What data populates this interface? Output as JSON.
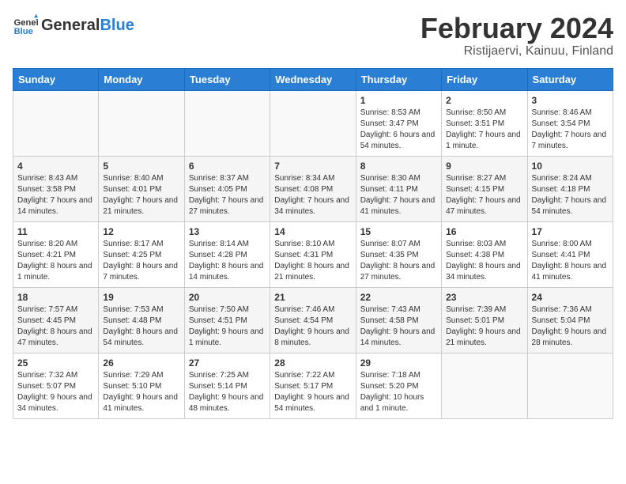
{
  "header": {
    "logo_general": "General",
    "logo_blue": "Blue",
    "month_title": "February 2024",
    "location": "Ristijaervi, Kainuu, Finland"
  },
  "weekdays": [
    "Sunday",
    "Monday",
    "Tuesday",
    "Wednesday",
    "Thursday",
    "Friday",
    "Saturday"
  ],
  "weeks": [
    [
      {
        "day": "",
        "info": ""
      },
      {
        "day": "",
        "info": ""
      },
      {
        "day": "",
        "info": ""
      },
      {
        "day": "",
        "info": ""
      },
      {
        "day": "1",
        "info": "Sunrise: 8:53 AM\nSunset: 3:47 PM\nDaylight: 6 hours and 54 minutes."
      },
      {
        "day": "2",
        "info": "Sunrise: 8:50 AM\nSunset: 3:51 PM\nDaylight: 7 hours and 1 minute."
      },
      {
        "day": "3",
        "info": "Sunrise: 8:46 AM\nSunset: 3:54 PM\nDaylight: 7 hours and 7 minutes."
      }
    ],
    [
      {
        "day": "4",
        "info": "Sunrise: 8:43 AM\nSunset: 3:58 PM\nDaylight: 7 hours and 14 minutes."
      },
      {
        "day": "5",
        "info": "Sunrise: 8:40 AM\nSunset: 4:01 PM\nDaylight: 7 hours and 21 minutes."
      },
      {
        "day": "6",
        "info": "Sunrise: 8:37 AM\nSunset: 4:05 PM\nDaylight: 7 hours and 27 minutes."
      },
      {
        "day": "7",
        "info": "Sunrise: 8:34 AM\nSunset: 4:08 PM\nDaylight: 7 hours and 34 minutes."
      },
      {
        "day": "8",
        "info": "Sunrise: 8:30 AM\nSunset: 4:11 PM\nDaylight: 7 hours and 41 minutes."
      },
      {
        "day": "9",
        "info": "Sunrise: 8:27 AM\nSunset: 4:15 PM\nDaylight: 7 hours and 47 minutes."
      },
      {
        "day": "10",
        "info": "Sunrise: 8:24 AM\nSunset: 4:18 PM\nDaylight: 7 hours and 54 minutes."
      }
    ],
    [
      {
        "day": "11",
        "info": "Sunrise: 8:20 AM\nSunset: 4:21 PM\nDaylight: 8 hours and 1 minute."
      },
      {
        "day": "12",
        "info": "Sunrise: 8:17 AM\nSunset: 4:25 PM\nDaylight: 8 hours and 7 minutes."
      },
      {
        "day": "13",
        "info": "Sunrise: 8:14 AM\nSunset: 4:28 PM\nDaylight: 8 hours and 14 minutes."
      },
      {
        "day": "14",
        "info": "Sunrise: 8:10 AM\nSunset: 4:31 PM\nDaylight: 8 hours and 21 minutes."
      },
      {
        "day": "15",
        "info": "Sunrise: 8:07 AM\nSunset: 4:35 PM\nDaylight: 8 hours and 27 minutes."
      },
      {
        "day": "16",
        "info": "Sunrise: 8:03 AM\nSunset: 4:38 PM\nDaylight: 8 hours and 34 minutes."
      },
      {
        "day": "17",
        "info": "Sunrise: 8:00 AM\nSunset: 4:41 PM\nDaylight: 8 hours and 41 minutes."
      }
    ],
    [
      {
        "day": "18",
        "info": "Sunrise: 7:57 AM\nSunset: 4:45 PM\nDaylight: 8 hours and 47 minutes."
      },
      {
        "day": "19",
        "info": "Sunrise: 7:53 AM\nSunset: 4:48 PM\nDaylight: 8 hours and 54 minutes."
      },
      {
        "day": "20",
        "info": "Sunrise: 7:50 AM\nSunset: 4:51 PM\nDaylight: 9 hours and 1 minute."
      },
      {
        "day": "21",
        "info": "Sunrise: 7:46 AM\nSunset: 4:54 PM\nDaylight: 9 hours and 8 minutes."
      },
      {
        "day": "22",
        "info": "Sunrise: 7:43 AM\nSunset: 4:58 PM\nDaylight: 9 hours and 14 minutes."
      },
      {
        "day": "23",
        "info": "Sunrise: 7:39 AM\nSunset: 5:01 PM\nDaylight: 9 hours and 21 minutes."
      },
      {
        "day": "24",
        "info": "Sunrise: 7:36 AM\nSunset: 5:04 PM\nDaylight: 9 hours and 28 minutes."
      }
    ],
    [
      {
        "day": "25",
        "info": "Sunrise: 7:32 AM\nSunset: 5:07 PM\nDaylight: 9 hours and 34 minutes."
      },
      {
        "day": "26",
        "info": "Sunrise: 7:29 AM\nSunset: 5:10 PM\nDaylight: 9 hours and 41 minutes."
      },
      {
        "day": "27",
        "info": "Sunrise: 7:25 AM\nSunset: 5:14 PM\nDaylight: 9 hours and 48 minutes."
      },
      {
        "day": "28",
        "info": "Sunrise: 7:22 AM\nSunset: 5:17 PM\nDaylight: 9 hours and 54 minutes."
      },
      {
        "day": "29",
        "info": "Sunrise: 7:18 AM\nSunset: 5:20 PM\nDaylight: 10 hours and 1 minute."
      },
      {
        "day": "",
        "info": ""
      },
      {
        "day": "",
        "info": ""
      }
    ]
  ]
}
